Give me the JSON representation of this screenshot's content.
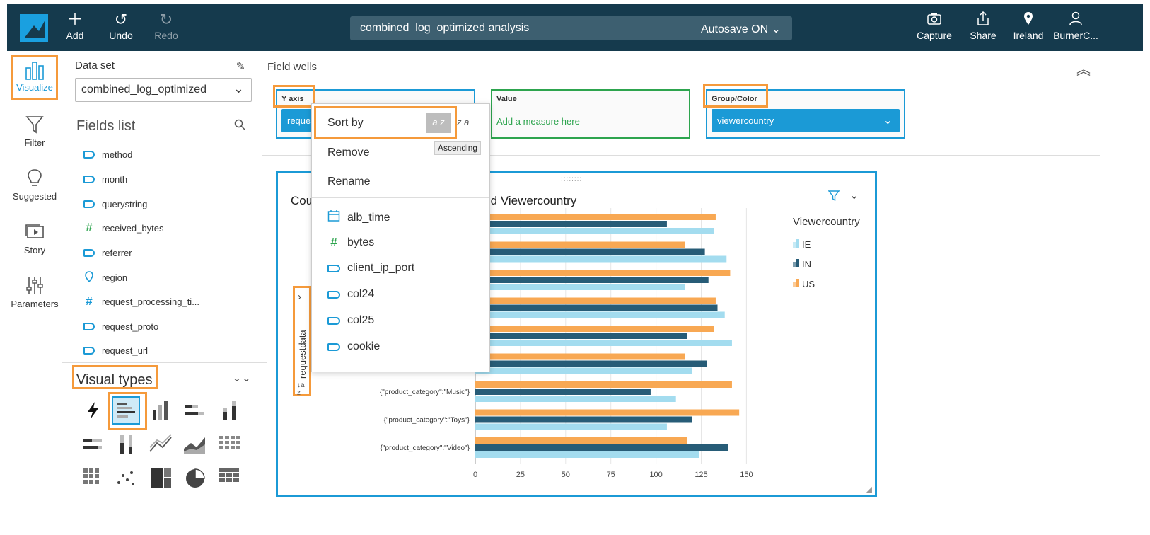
{
  "toolbar": {
    "add": "Add",
    "undo": "Undo",
    "redo": "Redo",
    "analysis_title": "combined_log_optimized analysis",
    "autosave": "Autosave ON",
    "capture": "Capture",
    "share": "Share",
    "region": "Ireland",
    "user": "BurnerC..."
  },
  "nav": {
    "visualize": "Visualize",
    "filter": "Filter",
    "suggested": "Suggested",
    "story": "Story",
    "parameters": "Parameters"
  },
  "dataset": {
    "label": "Data set",
    "selected": "combined_log_optimized"
  },
  "fields_list": {
    "title": "Fields list",
    "items": [
      {
        "name": "method",
        "type": "dimension"
      },
      {
        "name": "month",
        "type": "dimension"
      },
      {
        "name": "querystring",
        "type": "dimension"
      },
      {
        "name": "received_bytes",
        "type": "measure"
      },
      {
        "name": "referrer",
        "type": "dimension"
      },
      {
        "name": "region",
        "type": "geo"
      },
      {
        "name": "request_processing_ti...",
        "type": "measure"
      },
      {
        "name": "request_proto",
        "type": "dimension"
      },
      {
        "name": "request_url",
        "type": "dimension"
      }
    ]
  },
  "visual_types": {
    "title": "Visual types"
  },
  "field_wells": {
    "title": "Field wells",
    "y_axis": {
      "label": "Y axis",
      "value": "reques"
    },
    "value": {
      "label": "Value",
      "placeholder": "Add a measure here"
    },
    "group": {
      "label": "Group/Color",
      "value": "viewercountry"
    }
  },
  "menu": {
    "sort_by": "Sort by",
    "asc_icon": "a z",
    "desc_icon": "z a",
    "tooltip": "Ascending",
    "remove": "Remove",
    "rename": "Rename",
    "fields": [
      {
        "name": "alb_time",
        "type": "date"
      },
      {
        "name": "bytes",
        "type": "measure"
      },
      {
        "name": "client_ip_port",
        "type": "dimension"
      },
      {
        "name": "col24",
        "type": "dimension"
      },
      {
        "name": "col25",
        "type": "dimension"
      },
      {
        "name": "cookie",
        "type": "dimension"
      }
    ]
  },
  "chart_card": {
    "title_left": "Cou",
    "title_right": "nd Viewercountry",
    "y_field": "requestdata",
    "legend_title": "Viewercountry"
  },
  "chart_data": {
    "type": "bar",
    "orientation": "horizontal",
    "categories": [
      "",
      "",
      "",
      "",
      "",
      "",
      "{\"product_category\":\"Music\"}",
      "{\"product_category\":\"Toys\"}",
      "{\"product_category\":\"Video\"}"
    ],
    "series": [
      {
        "name": "IE",
        "color": "#a3dcef",
        "values": [
          132,
          139,
          116,
          138,
          142,
          120,
          111,
          106,
          124
        ]
      },
      {
        "name": "IN",
        "color": "#275c77",
        "values": [
          106,
          127,
          129,
          134,
          117,
          128,
          97,
          120,
          140
        ]
      },
      {
        "name": "US",
        "color": "#f8a853",
        "values": [
          133,
          116,
          141,
          133,
          132,
          116,
          142,
          146,
          117
        ]
      }
    ],
    "xticks": [
      0,
      25,
      50,
      75,
      100,
      125,
      150
    ],
    "xlim": [
      0,
      150
    ],
    "legend_position": "right"
  }
}
